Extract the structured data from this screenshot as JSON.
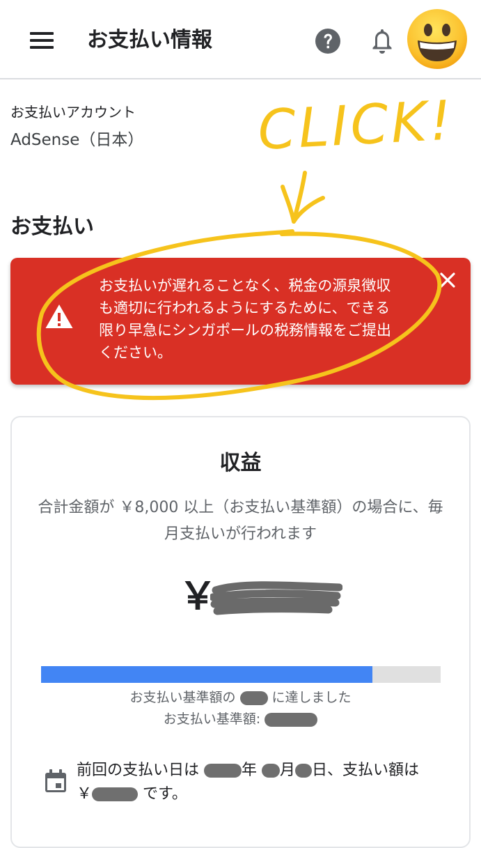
{
  "header": {
    "title": "お支払い情報",
    "icons": [
      "menu-icon",
      "help-icon",
      "bell-icon",
      "avatar-emoji"
    ]
  },
  "account": {
    "label": "お支払いアカウント",
    "value": "AdSense（日本）"
  },
  "payments": {
    "section_title": "お支払い",
    "alert": {
      "message": "お支払いが遅れることなく、税金の源泉徴収も適切に行われるようにするために、できる限り早急にシンガポールの税務情報をご提出ください。",
      "icon": "warning-icon",
      "close_icon": "close-icon",
      "background_color": "#d93025"
    }
  },
  "annotation": {
    "text": "CLICK!",
    "color": "#f6c31c"
  },
  "earnings": {
    "title": "収益",
    "description": "合計金額が ￥8,000 以上（お支払い基準額）の場合に、毎月支払いが行われます",
    "currency_symbol": "￥",
    "progress": 0.83,
    "progress_color": "#4285f4",
    "threshold_reached_before": "お支払い基準額の",
    "threshold_reached_after": "に達しました",
    "threshold_label": "お支払い基準額:",
    "last_payment": {
      "p1": "前回の支払い日は",
      "p2": "年",
      "p3": "月",
      "p4": "日、支払い額は ￥",
      "p5": "です。"
    }
  }
}
